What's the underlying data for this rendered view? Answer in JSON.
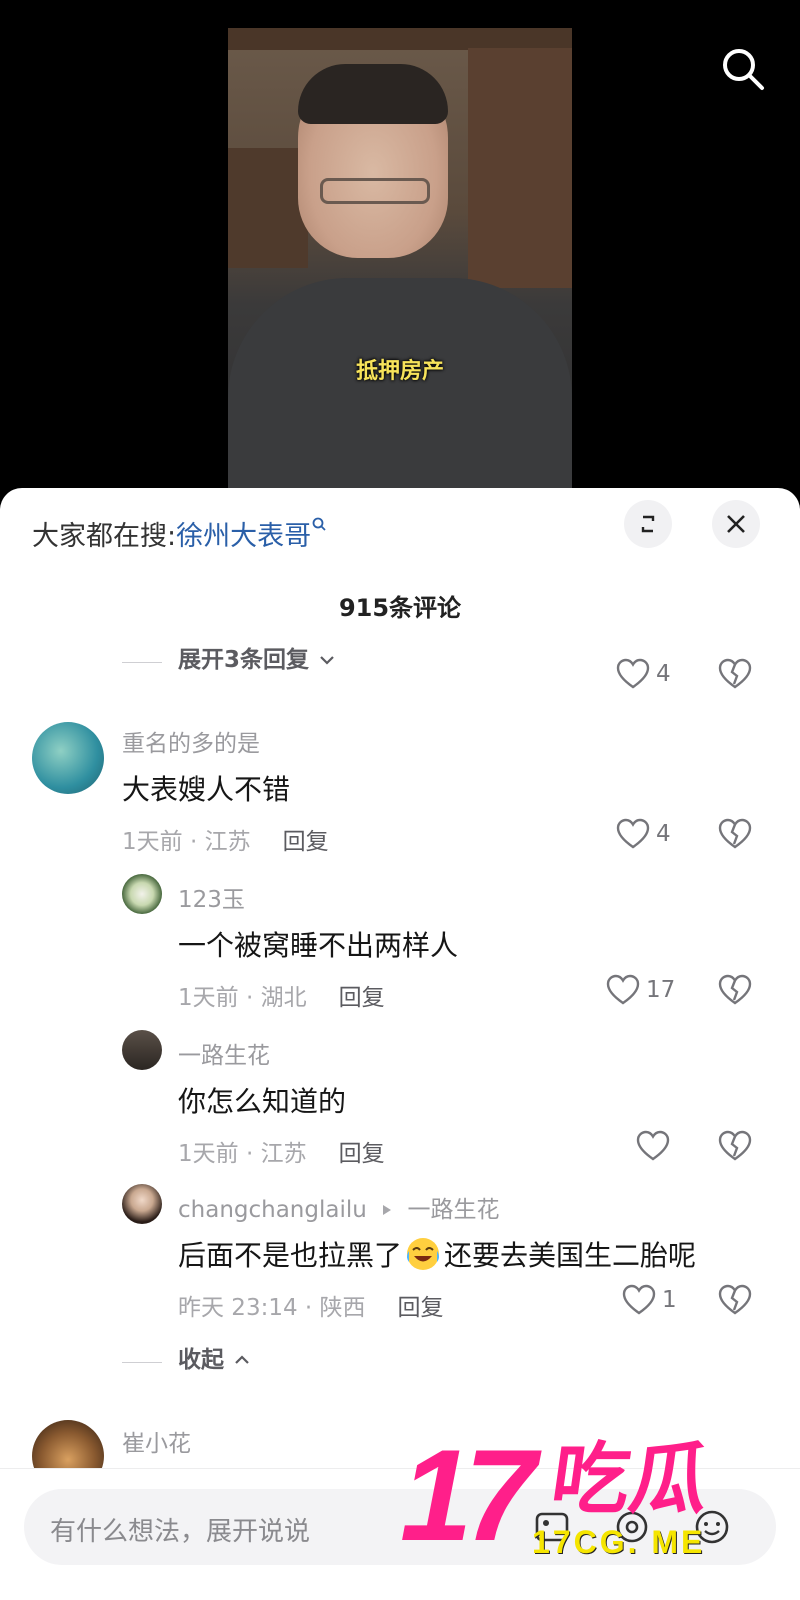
{
  "video": {
    "subtitle": "抵押房产"
  },
  "search_bar": {
    "prefix": "大家都在搜:",
    "keyword": "徐州大表哥"
  },
  "comments_header": {
    "count_label": "915条评论"
  },
  "thread": {
    "expand_label": "展开3条回复",
    "expand_likes": "4",
    "collapse_label": "收起"
  },
  "comments": [
    {
      "name": "重名的多的是",
      "text": "大表嫂人不错",
      "meta": "1天前 · 江苏",
      "reply_label": "回复",
      "likes": "4"
    },
    {
      "name": "123玉",
      "text": "一个被窝睡不出两样人",
      "meta": "1天前 · 湖北",
      "reply_label": "回复",
      "likes": "17"
    },
    {
      "name": "一路生花",
      "text": "你怎么知道的",
      "meta": "1天前 · 江苏",
      "reply_label": "回复",
      "likes": ""
    },
    {
      "name": "changchanglailu",
      "reply_to": "一路生花",
      "text_before": "后面不是也拉黑了",
      "text_after": "还要去美国生二胎呢",
      "meta": "昨天 23:14 · 陕西",
      "reply_label": "回复",
      "likes": "1"
    },
    {
      "name": "崔小花"
    }
  ],
  "input": {
    "placeholder": "有什么想法，展开说说"
  },
  "watermark": {
    "number": "17",
    "chars": "吃瓜",
    "url": "17CG. ME"
  },
  "icons": {
    "search": "search-icon",
    "expand": "expand-icon",
    "close": "close-icon",
    "like": "heart-icon",
    "dislike": "broken-heart-icon",
    "emoji": "cry-laugh-emoji-icon"
  }
}
